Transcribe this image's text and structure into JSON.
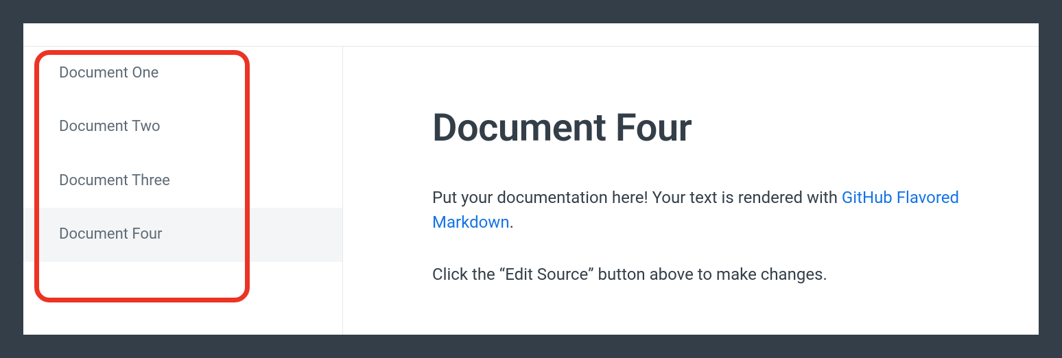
{
  "sidebar": {
    "items": [
      {
        "label": "Document One",
        "active": false
      },
      {
        "label": "Document Two",
        "active": false
      },
      {
        "label": "Document Three",
        "active": false
      },
      {
        "label": "Document Four",
        "active": true
      }
    ]
  },
  "main": {
    "title": "Document Four",
    "paragraph1_prefix": "Put your documentation here! Your text is rendered with ",
    "paragraph1_link": "GitHub Flavored Markdown",
    "paragraph1_suffix": ".",
    "paragraph2": "Click the “Edit Source” button above to make changes."
  }
}
